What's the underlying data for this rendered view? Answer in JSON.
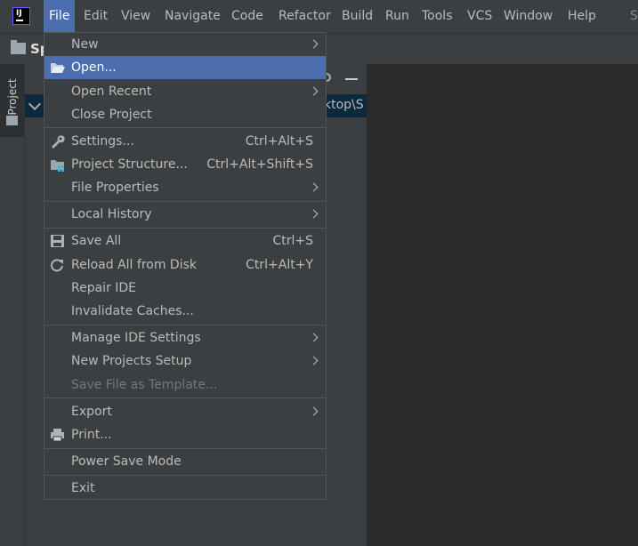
{
  "menubar": {
    "logo_text": "IJ",
    "items": [
      "File",
      "Edit",
      "View",
      "Navigate",
      "Code",
      "Refactor",
      "Build",
      "Run",
      "Tools",
      "VCS",
      "Window",
      "Help"
    ],
    "title_fragment": "S"
  },
  "toolbar": {
    "project_name": "Sp"
  },
  "left_strip": {
    "project_tab": "Project"
  },
  "project_panel": {
    "path_fragment": "ktop\\S"
  },
  "file_menu": {
    "items": [
      {
        "label": "New",
        "submenu": true
      },
      {
        "label": "Open...",
        "selected": true,
        "icon": "folder-open-icon"
      },
      {
        "label": "Open Recent",
        "submenu": true
      },
      {
        "label": "Close Project"
      },
      {
        "label": "Settings...",
        "shortcut": "Ctrl+Alt+S",
        "icon": "wrench-icon"
      },
      {
        "label": "Project Structure...",
        "shortcut": "Ctrl+Alt+Shift+S",
        "icon": "project-structure-icon"
      },
      {
        "label": "File Properties",
        "submenu": true
      },
      {
        "label": "Local History",
        "submenu": true
      },
      {
        "label": "Save All",
        "shortcut": "Ctrl+S",
        "icon": "save-icon"
      },
      {
        "label": "Reload All from Disk",
        "shortcut": "Ctrl+Alt+Y",
        "icon": "reload-icon"
      },
      {
        "label": "Repair IDE"
      },
      {
        "label": "Invalidate Caches..."
      },
      {
        "label": "Manage IDE Settings",
        "submenu": true
      },
      {
        "label": "New Projects Setup",
        "submenu": true
      },
      {
        "label": "Save File as Template...",
        "disabled": true
      },
      {
        "label": "Export",
        "submenu": true
      },
      {
        "label": "Print...",
        "icon": "print-icon"
      },
      {
        "label": "Power Save Mode"
      },
      {
        "label": "Exit"
      }
    ]
  },
  "colors": {
    "selection": "#4b6eaf",
    "menu_bg": "#3c3f41",
    "editor_bg": "#2b2b2b"
  }
}
